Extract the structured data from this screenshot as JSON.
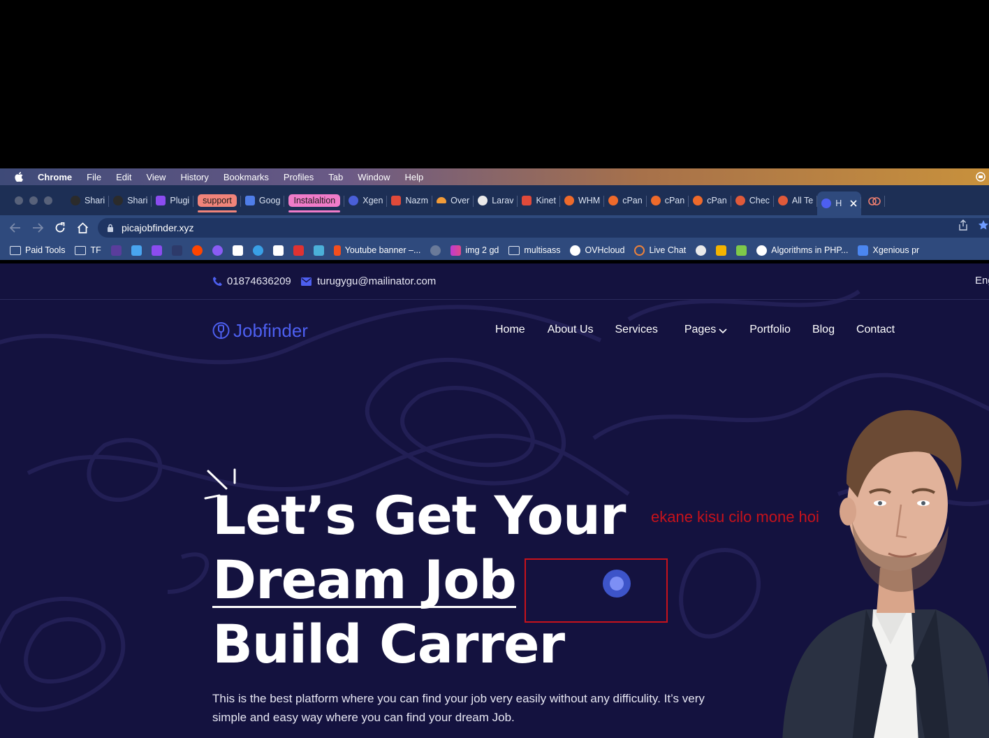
{
  "menubar": {
    "app": "Chrome",
    "items": [
      "File",
      "Edit",
      "View",
      "History",
      "Bookmarks",
      "Profiles",
      "Tab",
      "Window",
      "Help"
    ]
  },
  "tabs": [
    {
      "label": "Shari",
      "icon": "github-icon",
      "color": "#2b2b2b"
    },
    {
      "label": "Shari",
      "icon": "github-icon",
      "color": "#2b2b2b"
    },
    {
      "label": "Plugi",
      "icon": "x-brand-icon",
      "color": "#8b4cf0"
    },
    {
      "label": "support",
      "group": true
    },
    {
      "label": "Goog",
      "icon": "google-translate-icon",
      "color": "#4f7de8"
    },
    {
      "label": "Instalaltion",
      "group": true
    },
    {
      "label": "Xgen",
      "icon": "info-icon",
      "color": "#4a5fd8"
    },
    {
      "label": "Nazm",
      "icon": "x-close-app-icon",
      "color": "#e04a3a"
    },
    {
      "label": "Over",
      "icon": "cloud-icon",
      "color": "#f29b38"
    },
    {
      "label": "Larav",
      "icon": "globe-icon",
      "color": "#eaeaea"
    },
    {
      "label": "Kinet",
      "icon": "kinsta-icon",
      "color": "#e04a3a"
    },
    {
      "label": "WHM",
      "icon": "cpanel-icon",
      "color": "#ee6a2b"
    },
    {
      "label": "cPan",
      "icon": "cpanel-icon",
      "color": "#ee6a2b"
    },
    {
      "label": "cPan",
      "icon": "cpanel-icon",
      "color": "#ee6a2b"
    },
    {
      "label": "cPan",
      "icon": "cpanel-icon",
      "color": "#ee6a2b"
    },
    {
      "label": "Chec",
      "icon": "shield-icon",
      "color": "#e05a3a"
    },
    {
      "label": "All Te",
      "icon": "shield-icon",
      "color": "#e05a3a"
    },
    {
      "label": "H",
      "icon": "jobfinder-icon",
      "color": "#4d5ff0",
      "active": true
    }
  ],
  "toolbar": {
    "url": "picajobfinder.xyz"
  },
  "bookmarks": [
    {
      "label": "Paid Tools",
      "type": "folder"
    },
    {
      "label": "TF",
      "type": "folder"
    },
    {
      "label": "",
      "icon": "xtemos-icon",
      "color": "#5a3d9c"
    },
    {
      "label": "",
      "icon": "chat-icon",
      "color": "#49a5f0"
    },
    {
      "label": "",
      "icon": "x-brand-icon",
      "color": "#8b4cf0"
    },
    {
      "label": "",
      "icon": "dark-square-icon",
      "color": "#2d3a6a"
    },
    {
      "label": "",
      "icon": "reddit-icon",
      "color": "#ff4500"
    },
    {
      "label": "",
      "icon": "messenger-icon",
      "color": "#8a5cf5"
    },
    {
      "label": "",
      "icon": "notion-icon",
      "color": "#ffffff"
    },
    {
      "label": "",
      "icon": "swirl-icon",
      "color": "#39a0e6"
    },
    {
      "label": "",
      "icon": "cl-icon",
      "color": "#ffffff"
    },
    {
      "label": "",
      "icon": "it-icon",
      "color": "#e03232"
    },
    {
      "label": "",
      "icon": "docker-icon",
      "color": "#4bb0d9"
    },
    {
      "label": "Youtube banner –...",
      "icon": "figma-icon",
      "color": "#f24e1e"
    },
    {
      "label": "",
      "icon": "pie-icon",
      "color": "#6a7a99"
    },
    {
      "label": "img 2 gd",
      "icon": "gradient-icon",
      "color": "#c03ad0"
    },
    {
      "label": "multisass",
      "type": "folder"
    },
    {
      "label": "OVHcloud",
      "icon": "ovh-icon",
      "color": "#ffffff"
    },
    {
      "label": "Live Chat",
      "icon": "ring-icon",
      "color": "#f0833a"
    },
    {
      "label": "",
      "icon": "globe-icon",
      "color": "#eaeaea"
    },
    {
      "label": "",
      "icon": "bar-chart-icon",
      "color": "#f4b400"
    },
    {
      "label": "",
      "icon": "check-icon",
      "color": "#7ec84a"
    },
    {
      "label": "Algorithms in PHP...",
      "icon": "wordpress-icon",
      "color": "#ffffff"
    },
    {
      "label": "Xgenious pr",
      "icon": "doc-icon",
      "color": "#4b86f0"
    }
  ],
  "site": {
    "phone": "01874636209",
    "email": "turugygu@mailinator.com",
    "lang": "Eng",
    "logo": "Jobfinder",
    "nav": [
      "Home",
      "About Us",
      "Services",
      "Pages",
      "Portfolio",
      "Blog",
      "Contact"
    ],
    "hero": {
      "line1": "Let’s Get Your",
      "line2": "Dream Job",
      "line3": "Build Carrer",
      "desc": "This is the best platform where you can find your job very easily without any difficulity. It’s very simple and easy way where you can find your dream Job."
    },
    "annotation": "ekane kisu cilo mone hoi",
    "colors": {
      "background": "#14123f",
      "accent": "#4d5ff0",
      "annotation": "#c8121b"
    }
  }
}
